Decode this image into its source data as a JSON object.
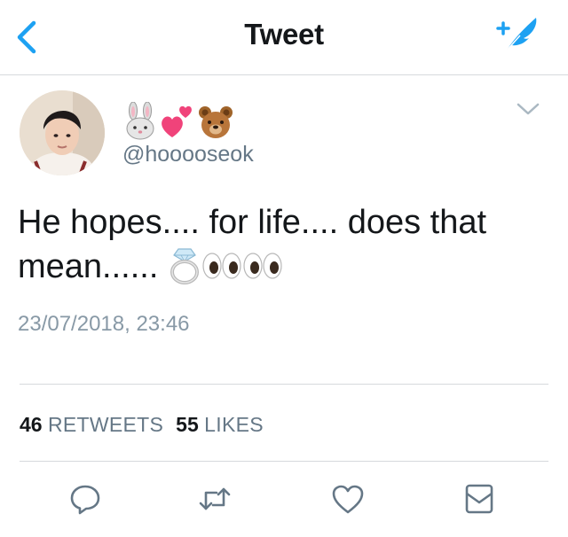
{
  "header": {
    "title": "Tweet",
    "back_icon": "chevron-left-icon",
    "compose_icon": "compose-feather-icon",
    "accent_color": "#1da1f2"
  },
  "author": {
    "display_name_emojis": [
      "rabbit-face-emoji",
      "two-hearts-emoji",
      "bear-face-emoji"
    ],
    "handle": "@hooooseok"
  },
  "tweet": {
    "text_line1": "He hopes.... for life.... does that",
    "text_line2": "mean......",
    "trailing_emojis": [
      "ring-emoji",
      "eyes-emoji",
      "eyes-emoji"
    ],
    "timestamp": "23/07/2018, 23:46"
  },
  "stats": {
    "retweets_count": "46",
    "retweets_label": "RETWEETS",
    "likes_count": "55",
    "likes_label": "LIKES"
  },
  "actions": [
    "reply-icon",
    "retweet-icon",
    "like-heart-icon",
    "direct-message-icon"
  ]
}
